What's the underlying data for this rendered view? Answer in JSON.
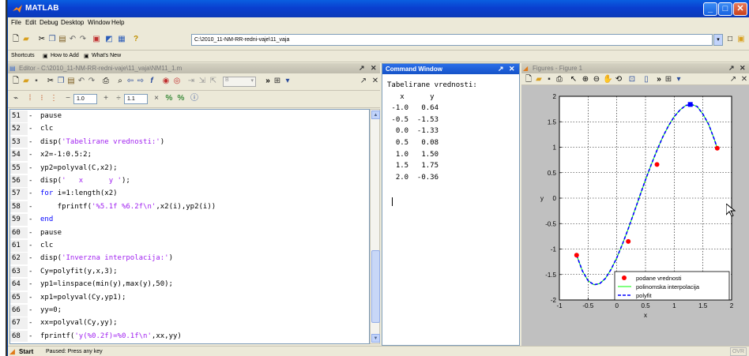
{
  "window": {
    "title": "MATLAB"
  },
  "menu": [
    "File",
    "Edit",
    "Debug",
    "Desktop",
    "Window",
    "Help"
  ],
  "toolbar": {
    "current_folder": "C:\\2010_11-NM-RR-redni-vaje\\11_vaja"
  },
  "shortcuts": {
    "how_to_add": "How to Add",
    "whats_new": "What's New",
    "label": "Shortcuts"
  },
  "editor": {
    "title": "Editor - C:\\2010_11-NM-RR-redni-vaje\\11_vaja\\NM11_1.m",
    "cell_minus_value": "1.0",
    "cell_div_value": "1.1",
    "lines": [
      {
        "n": "51",
        "parts": [
          {
            "t": "pause",
            "c": ""
          }
        ]
      },
      {
        "n": "52",
        "parts": [
          {
            "t": "clc",
            "c": ""
          }
        ]
      },
      {
        "n": "53",
        "parts": [
          {
            "t": "disp(",
            "c": ""
          },
          {
            "t": "'Tabelirane vrednosti:'",
            "c": "str"
          },
          {
            "t": ")",
            "c": ""
          }
        ]
      },
      {
        "n": "54",
        "parts": [
          {
            "t": "x2=-1:0.5:2;",
            "c": ""
          }
        ]
      },
      {
        "n": "55",
        "parts": [
          {
            "t": "yp2=polyval(C,x2);",
            "c": ""
          }
        ]
      },
      {
        "n": "56",
        "parts": [
          {
            "t": "disp(",
            "c": ""
          },
          {
            "t": "'   x      y '",
            "c": "str"
          },
          {
            "t": ");",
            "c": ""
          }
        ]
      },
      {
        "n": "57",
        "parts": [
          {
            "t": "for",
            "c": "kw"
          },
          {
            "t": " i=1:length(x2)",
            "c": ""
          }
        ]
      },
      {
        "n": "58",
        "parts": [
          {
            "t": "    fprintf(",
            "c": ""
          },
          {
            "t": "'%5.1f %6.2f\\n'",
            "c": "str"
          },
          {
            "t": ",x2(i),yp2(i))",
            "c": ""
          }
        ]
      },
      {
        "n": "59",
        "parts": [
          {
            "t": "end",
            "c": "kw"
          }
        ]
      },
      {
        "n": "60",
        "parts": [
          {
            "t": "pause",
            "c": ""
          }
        ]
      },
      {
        "n": "61",
        "parts": [
          {
            "t": "clc",
            "c": ""
          }
        ]
      },
      {
        "n": "62",
        "parts": [
          {
            "t": "disp(",
            "c": ""
          },
          {
            "t": "'Inverzna interpolacija:'",
            "c": "str"
          },
          {
            "t": ")",
            "c": ""
          }
        ]
      },
      {
        "n": "63",
        "parts": [
          {
            "t": "Cy=polyfit(y,x,3);",
            "c": ""
          }
        ]
      },
      {
        "n": "64",
        "parts": [
          {
            "t": "yp1=linspace(min(y),max(y),50);",
            "c": ""
          }
        ]
      },
      {
        "n": "65",
        "parts": [
          {
            "t": "xp1=polyval(Cy,yp1);",
            "c": ""
          }
        ]
      },
      {
        "n": "66",
        "parts": [
          {
            "t": "yy=0;",
            "c": ""
          }
        ]
      },
      {
        "n": "67",
        "parts": [
          {
            "t": "xx=polyval(Cy,yy);",
            "c": ""
          }
        ]
      },
      {
        "n": "68",
        "parts": [
          {
            "t": "fprintf(",
            "c": ""
          },
          {
            "t": "'y(%0.2f)=%0.1f\\n'",
            "c": "str"
          },
          {
            "t": ",xx,yy)",
            "c": ""
          }
        ]
      }
    ]
  },
  "command_window": {
    "title": "Command Window",
    "output": "Tabelirane vrednosti:\n   x      y\n -1.0   0.64\n -0.5  -1.53\n  0.0  -1.33\n  0.5   0.08\n  1.0   1.50\n  1.5   1.75\n  2.0  -0.36"
  },
  "figure": {
    "title": "Figures - Figure 1",
    "chart_data": {
      "type": "line",
      "xlabel": "x",
      "ylabel": "y",
      "xlim": [
        -1,
        2
      ],
      "ylim": [
        -2,
        2
      ],
      "xticks": [
        "-1",
        "-0.5",
        "0",
        "0.5",
        "1",
        "1.5",
        "2"
      ],
      "yticks": [
        "-2",
        "-1.5",
        "-1",
        "-0.5",
        "0",
        "0.5",
        "1",
        "1.5",
        "2"
      ],
      "grid": true,
      "legend_position": "bottom-right",
      "series": [
        {
          "name": "podane vrednosti",
          "style": "markers",
          "color": "#ff0000",
          "x": [
            -0.7,
            0.2,
            0.7,
            1.75
          ],
          "y": [
            -1.12,
            -0.85,
            0.66,
            0.98
          ]
        },
        {
          "name": "polinomska interpolacija",
          "style": "solid",
          "color": "#00ff00",
          "x": [
            -0.7,
            -0.6,
            -0.5,
            -0.4,
            -0.3,
            -0.2,
            -0.1,
            0.0,
            0.1,
            0.2,
            0.3,
            0.4,
            0.5,
            0.6,
            0.7,
            0.8,
            0.9,
            1.0,
            1.1,
            1.2,
            1.3,
            1.4,
            1.5,
            1.6,
            1.7,
            1.75
          ],
          "y": [
            -1.12,
            -1.43,
            -1.62,
            -1.7,
            -1.68,
            -1.58,
            -1.4,
            -1.17,
            -0.9,
            -0.6,
            -0.28,
            0.04,
            0.36,
            0.66,
            0.94,
            1.2,
            1.42,
            1.6,
            1.73,
            1.82,
            1.84,
            1.8,
            1.65,
            1.45,
            1.15,
            0.98
          ]
        },
        {
          "name": "polyfit",
          "style": "dashed",
          "color": "#0000ff",
          "x": [
            -0.7,
            -0.6,
            -0.5,
            -0.4,
            -0.3,
            -0.2,
            -0.1,
            0.0,
            0.1,
            0.2,
            0.3,
            0.4,
            0.5,
            0.6,
            0.7,
            0.8,
            0.9,
            1.0,
            1.1,
            1.2,
            1.3,
            1.4,
            1.5,
            1.6,
            1.7,
            1.75
          ],
          "y": [
            -1.12,
            -1.43,
            -1.62,
            -1.7,
            -1.68,
            -1.58,
            -1.4,
            -1.17,
            -0.9,
            -0.6,
            -0.28,
            0.04,
            0.36,
            0.66,
            0.94,
            1.2,
            1.42,
            1.6,
            1.73,
            1.82,
            1.84,
            1.8,
            1.65,
            1.45,
            1.15,
            0.98
          ]
        }
      ],
      "highlight_point": {
        "x": 1.28,
        "y": 1.84,
        "color": "#0000ff"
      }
    }
  },
  "status": {
    "start": "Start",
    "text": "Paused: Press any key",
    "ovr": "OVR"
  },
  "colors": {
    "title_blue": "#0a4fd8",
    "keyword": "#0000ff",
    "string": "#a020f0"
  }
}
